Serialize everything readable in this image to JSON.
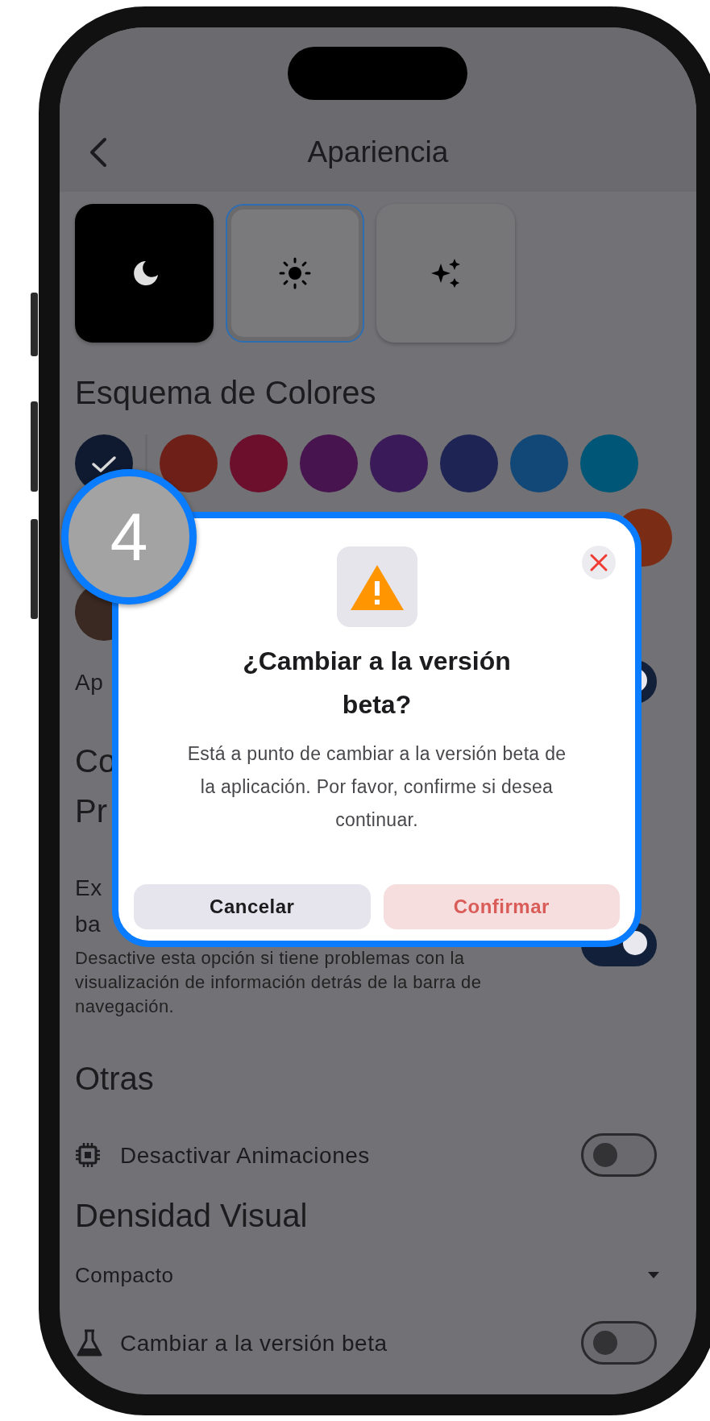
{
  "header": {
    "title": "Apariencia"
  },
  "theme_options": [
    {
      "kind": "dark",
      "selected": false
    },
    {
      "kind": "light",
      "selected": true
    },
    {
      "kind": "auto",
      "selected": false
    }
  ],
  "color_scheme": {
    "title": "Esquema de Colores",
    "swatch_rows": [
      {
        "swatches": [
          {
            "color": "#0f1a30",
            "selected": true
          },
          {
            "color": "#6e2018",
            "selected": false
          },
          {
            "color": "#6c0f2c",
            "selected": false
          },
          {
            "color": "#481450",
            "selected": false
          },
          {
            "color": "#3a1a58",
            "selected": false
          },
          {
            "color": "#1e2454",
            "selected": false
          },
          {
            "color": "#114878",
            "selected": false
          },
          {
            "color": "#005676",
            "selected": false
          }
        ]
      },
      {
        "swatches": [
          {
            "color": "#7a2c14",
            "selected": false
          }
        ]
      },
      {
        "swatches": [
          {
            "color": "#3a2822",
            "selected": false
          }
        ]
      }
    ]
  },
  "sections": [
    {
      "kind": "toggle",
      "label_lines": [
        "Ap"
      ],
      "on": true
    },
    {
      "kind": "heading",
      "lines": [
        "Co",
        "Pr"
      ]
    },
    {
      "kind": "toggle",
      "label_lines": [
        "Ex",
        "ba"
      ],
      "on": true,
      "description": "Desactive esta opción si tiene problemas con la visualización de información detrás de la barra de navegación."
    },
    {
      "kind": "heading",
      "lines": [
        "Otras"
      ]
    },
    {
      "kind": "toggle",
      "label_lines": [
        "Desactivar Animaciones"
      ],
      "on": false
    },
    {
      "kind": "heading",
      "lines": [
        "Densidad Visual"
      ]
    },
    {
      "kind": "select",
      "value": "Compacto"
    },
    {
      "kind": "toggle",
      "label_lines": [
        "Cambiar a la versión beta"
      ],
      "on": false
    }
  ],
  "dialog": {
    "title": "¿Cambiar a la versión beta?",
    "message": "Está a punto de cambiar a la versión beta de la aplicación. Por favor, confirme si desea continuar.",
    "buttons": [
      {
        "label": "Cancelar",
        "kind": "cancel"
      },
      {
        "label": "Confirmar",
        "kind": "confirm"
      }
    ]
  },
  "step_badge": "4"
}
